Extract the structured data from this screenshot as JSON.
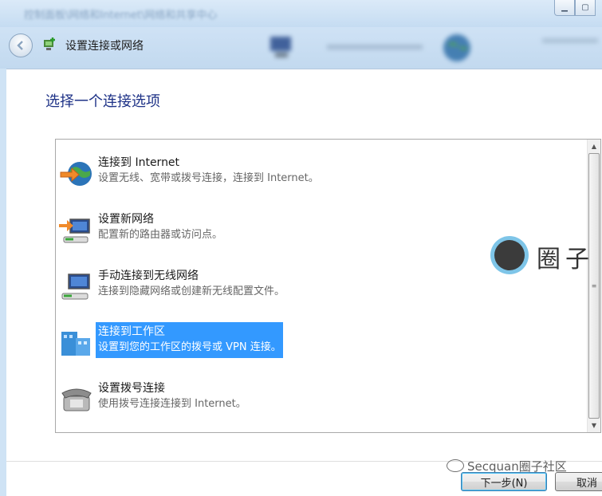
{
  "window": {
    "blurred_title": "控制面板\\网络和Internet\\网络和共享中心",
    "minimize_icon": "minimize-icon",
    "maximize_icon": "maximize-icon"
  },
  "nav": {
    "title": "设置连接或网络",
    "back_icon": "back-arrow-icon",
    "wizard_icon": "network-setup-icon"
  },
  "main": {
    "heading": "选择一个连接选项",
    "options": [
      {
        "title": "连接到 Internet",
        "desc": "设置无线、宽带或拨号连接，连接到 Internet。",
        "icon": "globe-icon",
        "selected": false
      },
      {
        "title": "设置新网络",
        "desc": "配置新的路由器或访问点。",
        "icon": "new-network-icon",
        "selected": false
      },
      {
        "title": "手动连接到无线网络",
        "desc": "连接到隐藏网络或创建新无线配置文件。",
        "icon": "wireless-icon",
        "selected": false
      },
      {
        "title": "连接到工作区",
        "desc": "设置到您的工作区的拨号或 VPN 连接。",
        "icon": "workplace-icon",
        "selected": true
      },
      {
        "title": "设置拨号连接",
        "desc": "使用拨号连接连接到 Internet。",
        "icon": "phone-icon",
        "selected": false
      }
    ]
  },
  "watermark": {
    "side_text": "圈子",
    "bottom_text": "Secquan圈子社区"
  },
  "buttons": {
    "next_label": "下一步(N)",
    "cancel_label": "取消"
  },
  "colors": {
    "heading": "#1e3287",
    "selection": "#3399ff",
    "description": "#666666"
  }
}
